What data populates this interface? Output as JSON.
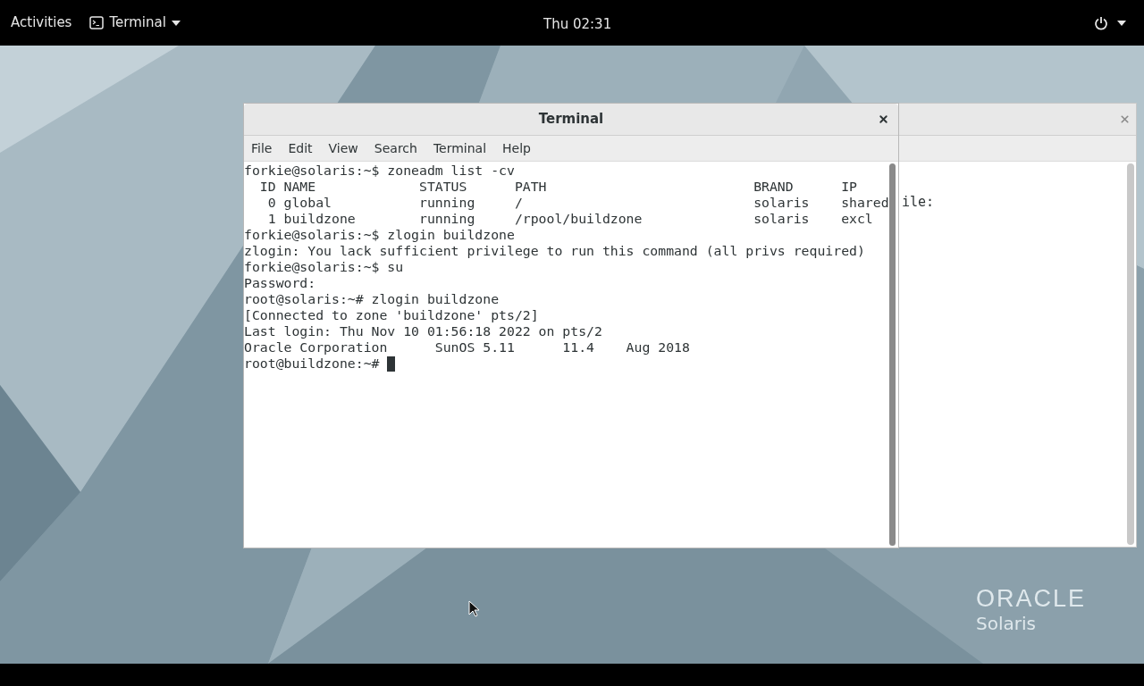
{
  "top_bar": {
    "activities": "Activities",
    "app_menu": "Terminal",
    "clock": "Thu 02:31"
  },
  "back_window": {
    "text": "ile:"
  },
  "terminal": {
    "title": "Terminal",
    "menu": [
      "File",
      "Edit",
      "View",
      "Search",
      "Terminal",
      "Help"
    ],
    "lines": [
      "forkie@solaris:~$ zoneadm list -cv",
      "  ID NAME             STATUS      PATH                          BRAND      IP",
      "   0 global           running     /                             solaris    shared",
      "   1 buildzone        running     /rpool/buildzone              solaris    excl",
      "forkie@solaris:~$ zlogin buildzone",
      "zlogin: You lack sufficient privilege to run this command (all privs required)",
      "forkie@solaris:~$ su",
      "Password:",
      "root@solaris:~# zlogin buildzone",
      "[Connected to zone 'buildzone' pts/2]",
      "Last login: Thu Nov 10 01:56:18 2022 on pts/2",
      "Oracle Corporation      SunOS 5.11      11.4    Aug 2018"
    ],
    "prompt": "root@buildzone:~# "
  },
  "logo": {
    "brand": "ORACLE",
    "product": "Solaris"
  }
}
